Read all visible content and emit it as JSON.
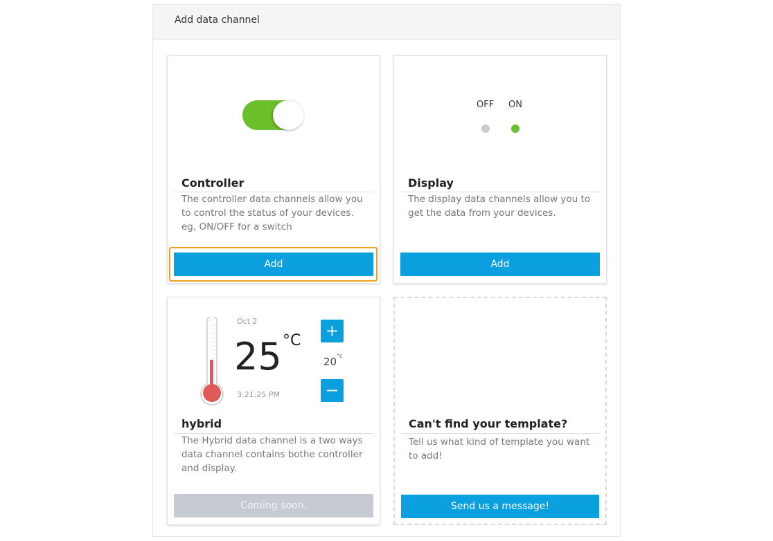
{
  "panel": {
    "title": "Add data channel"
  },
  "cards": {
    "controller": {
      "title": "Controller",
      "description": "The controller data channels allow you to control the status of your devices. eg, ON/OFF for a switch",
      "button": "Add",
      "toggle_state": "on"
    },
    "display": {
      "title": "Display",
      "description": "The display data channels allow you to get the data from your devices.",
      "button": "Add",
      "off_label": "OFF",
      "on_label": "ON"
    },
    "hybrid": {
      "title": "hybrid",
      "description": "The Hybrid data channel is a two ways data channel contains bothe controller and display.",
      "button": "Coming soon.",
      "date": "Oct 2",
      "temperature": "25",
      "temperature_unit": "°C",
      "setpoint": "20",
      "setpoint_unit": "°c",
      "time": "3:21:25 PM",
      "thermometer_fill_fraction": 0.35
    },
    "custom": {
      "title": "Can't find your template?",
      "description": "Tell us what kind of template you want to add!",
      "button": "Send us a message!"
    }
  },
  "colors": {
    "accent": "#0aa0e0",
    "toggle_on": "#6abf2a",
    "dot_on": "#6abf2a",
    "dot_off": "#cccccc",
    "focus": "#f0a020",
    "thermo_fill": "#e05a5a",
    "disabled": "#c6cbd3"
  }
}
